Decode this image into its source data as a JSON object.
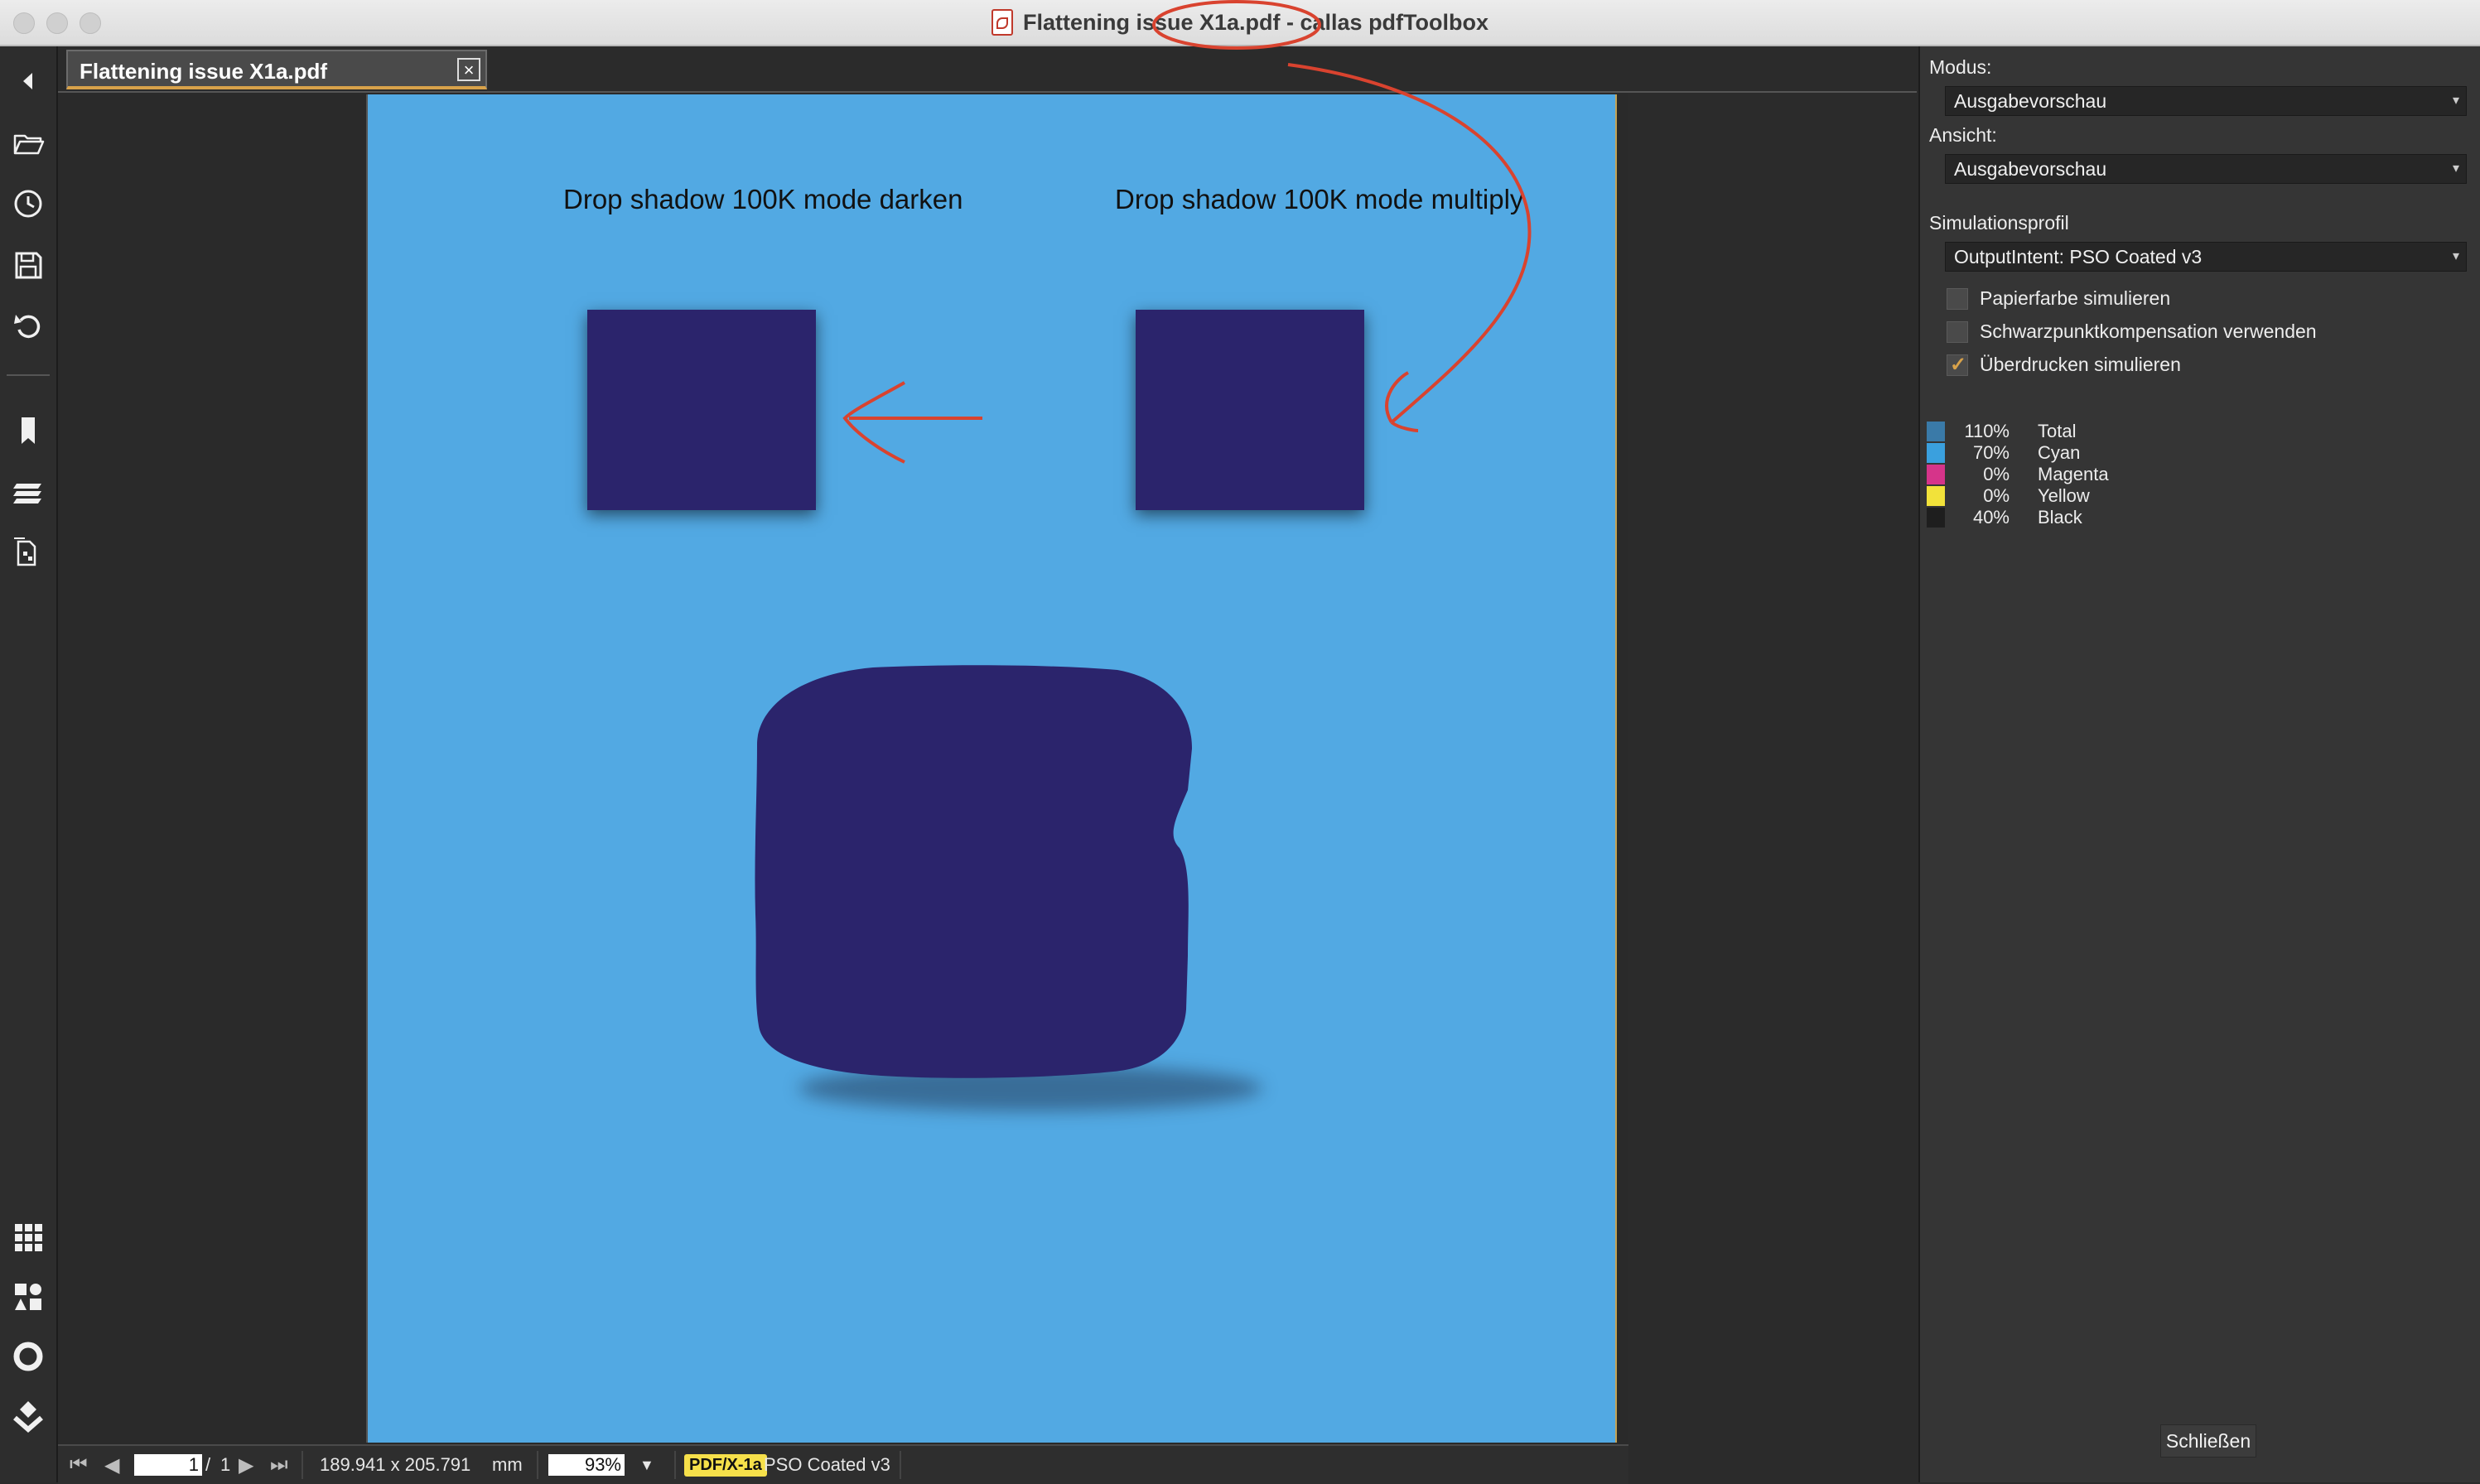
{
  "window": {
    "title": "Flattening issue X1a.pdf - callas pdfToolbox"
  },
  "left_toolbar": {
    "icons": [
      "back-icon",
      "folder-open-icon",
      "history-clock-icon",
      "save-icon",
      "revert-icon",
      "bookmark-icon",
      "layers-icon",
      "page-thumbnails-icon",
      "grid-icon",
      "tools-icon",
      "circle-icon",
      "check-icon"
    ]
  },
  "tab": {
    "label": "Flattening issue X1a.pdf",
    "close": "×"
  },
  "document": {
    "caption_left": "Drop shadow 100K mode darken",
    "caption_right": "Drop shadow 100K mode multiply",
    "page_color": "#52a9e3",
    "object_color": "#2b246c"
  },
  "statusbar": {
    "page_current": "1",
    "page_separator": "/",
    "page_total": "1",
    "dimensions": "189.941 x 205.791",
    "unit": "mm",
    "zoom": "93%",
    "zoom_caret": "▼",
    "pdfx_badge": "PDF/X-1a",
    "profile": "PSO Coated v3"
  },
  "right_panel": {
    "modus_label": "Modus:",
    "modus_value": "Ausgabevorschau",
    "ansicht_label": "Ansicht:",
    "ansicht_value": "Ausgabevorschau",
    "sim_label": "Simulationsprofil",
    "sim_value": "OutputIntent: PSO Coated v3",
    "checkboxes": [
      {
        "label": "Papierfarbe simulieren",
        "checked": false
      },
      {
        "label": "Schwarzpunktkompensation verwenden",
        "checked": false
      },
      {
        "label": "Überdrucken simulieren",
        "checked": true
      }
    ],
    "inks": [
      {
        "pct": "110%",
        "name": "Total",
        "color": "#3a7aa8"
      },
      {
        "pct": "70%",
        "name": "Cyan",
        "color": "#3aa0de"
      },
      {
        "pct": "0%",
        "name": "Magenta",
        "color": "#d6348a"
      },
      {
        "pct": "0%",
        "name": "Yellow",
        "color": "#f2e23a"
      },
      {
        "pct": "40%",
        "name": "Black",
        "color": "#1e1e1e"
      }
    ],
    "close_button": "Schließen"
  },
  "annotation_color": "#d9432f"
}
